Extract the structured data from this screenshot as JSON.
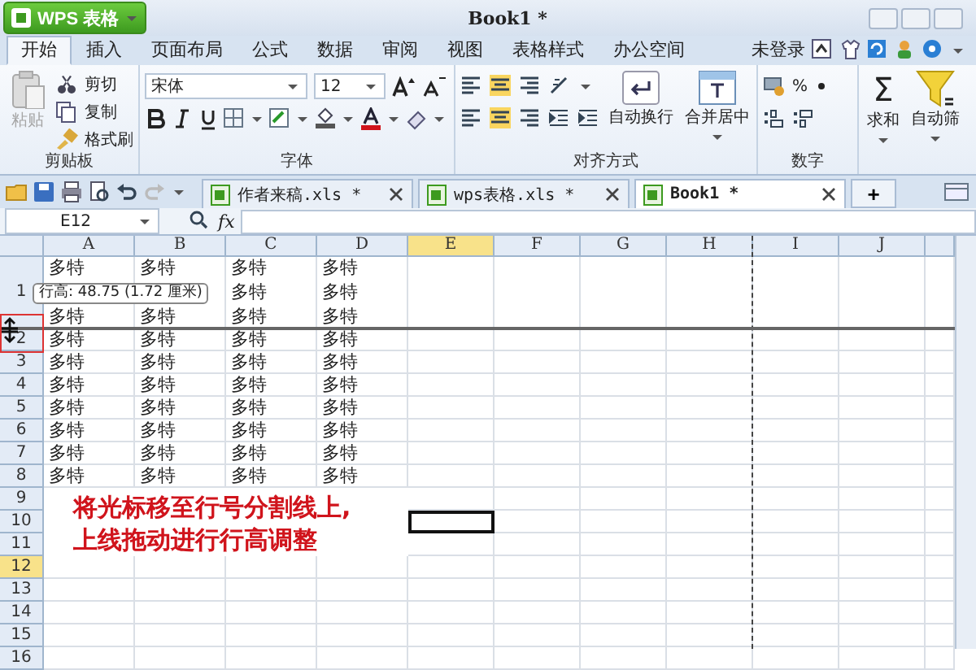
{
  "title_bar": {
    "app_button": "WPS 表格",
    "title": "Book1 *"
  },
  "ribbon_tabs": [
    {
      "label": "开始",
      "selected": true
    },
    {
      "label": "插入",
      "selected": false
    },
    {
      "label": "页面布局",
      "selected": false
    },
    {
      "label": "公式",
      "selected": false
    },
    {
      "label": "数据",
      "selected": false
    },
    {
      "label": "审阅",
      "selected": false
    },
    {
      "label": "视图",
      "selected": false
    },
    {
      "label": "表格样式",
      "selected": false
    },
    {
      "label": "办公空间",
      "selected": false
    }
  ],
  "account": {
    "label": "未登录"
  },
  "ribbon": {
    "clipboard": {
      "paste": {
        "label": "粘贴",
        "disabled": true
      },
      "items": [
        "剪切",
        "复制",
        "格式刷"
      ],
      "title": "剪贴板"
    },
    "font": {
      "name": "宋体",
      "size": "12",
      "title": "字体"
    },
    "alignment": {
      "wrap": "自动换行",
      "merge": "合并居中",
      "title": "对齐方式"
    },
    "number": {
      "percent": "%",
      "title": "数字"
    },
    "sum": {
      "icon": "Σ",
      "label": "求和"
    },
    "filter": {
      "label": "自动筛"
    }
  },
  "documents": [
    {
      "name": "作者来稿.xls *",
      "selected": false
    },
    {
      "name": "wps表格.xls *",
      "selected": false
    },
    {
      "name": "Book1 *",
      "selected": true
    }
  ],
  "add_tab": "+",
  "formula_bar": {
    "cell": "E12",
    "function_label": "fx"
  },
  "columns": [
    {
      "label": "A",
      "selected": false
    },
    {
      "label": "B",
      "selected": false
    },
    {
      "label": "C",
      "selected": false
    },
    {
      "label": "D",
      "selected": false
    },
    {
      "label": "E",
      "selected": true
    },
    {
      "label": "F",
      "selected": false
    },
    {
      "label": "G",
      "selected": false
    },
    {
      "label": "H",
      "selected": false
    },
    {
      "label": "I",
      "selected": false
    },
    {
      "label": "J",
      "selected": false
    }
  ],
  "rows": [
    {
      "label": "1",
      "selected": false,
      "tall": true,
      "selection_box": false,
      "cells": [
        [
          "多特",
          "多特"
        ],
        [
          "多特",
          "多特"
        ],
        [
          "多特",
          "多特",
          "多特"
        ],
        [
          "多特",
          "多特",
          "多特"
        ]
      ]
    },
    {
      "label": "2",
      "selected": false,
      "tall": false,
      "selection_box": false,
      "cells": [
        [
          "多特"
        ],
        [
          "多特"
        ],
        [
          "多特"
        ],
        [
          "多特"
        ]
      ]
    },
    {
      "label": "3",
      "selected": false,
      "tall": false,
      "selection_box": false,
      "cells": [
        [
          "多特"
        ],
        [
          "多特"
        ],
        [
          "多特"
        ],
        [
          "多特"
        ]
      ]
    },
    {
      "label": "4",
      "selected": false,
      "tall": false,
      "selection_box": false,
      "cells": [
        [
          "多特"
        ],
        [
          "多特"
        ],
        [
          "多特"
        ],
        [
          "多特"
        ]
      ]
    },
    {
      "label": "5",
      "selected": false,
      "tall": false,
      "selection_box": false,
      "cells": [
        [
          "多特"
        ],
        [
          "多特"
        ],
        [
          "多特"
        ],
        [
          "多特"
        ]
      ]
    },
    {
      "label": "6",
      "selected": false,
      "tall": false,
      "selection_box": false,
      "cells": [
        [
          "多特"
        ],
        [
          "多特"
        ],
        [
          "多特"
        ],
        [
          "多特"
        ]
      ]
    },
    {
      "label": "7",
      "selected": false,
      "tall": false,
      "selection_box": false,
      "cells": [
        [
          "多特"
        ],
        [
          "多特"
        ],
        [
          "多特"
        ],
        [
          "多特"
        ]
      ]
    },
    {
      "label": "8",
      "selected": false,
      "tall": false,
      "selection_box": false,
      "cells": [
        [
          "多特"
        ],
        [
          "多特"
        ],
        [
          "多特"
        ],
        [
          "多特"
        ]
      ]
    },
    {
      "label": "9",
      "selected": false,
      "tall": false,
      "selection_box": false,
      "cells": []
    },
    {
      "label": "10",
      "selected": false,
      "tall": false,
      "selection_box": true,
      "cells": []
    },
    {
      "label": "11",
      "selected": false,
      "tall": false,
      "selection_box": false,
      "cells": []
    },
    {
      "label": "12",
      "selected": true,
      "tall": false,
      "selection_box": false,
      "cells": []
    },
    {
      "label": "13",
      "selected": false,
      "tall": false,
      "selection_box": false,
      "cells": []
    },
    {
      "label": "14",
      "selected": false,
      "tall": false,
      "selection_box": false,
      "cells": []
    },
    {
      "label": "15",
      "selected": false,
      "tall": false,
      "selection_box": false,
      "cells": []
    },
    {
      "label": "16",
      "selected": false,
      "tall": false,
      "selection_box": false,
      "cells": []
    }
  ],
  "tooltip": "行高: 48.75 (1.72 厘米)",
  "annotation": [
    "将光标移至行号分割线上,",
    "上线拖动进行行高调整"
  ]
}
